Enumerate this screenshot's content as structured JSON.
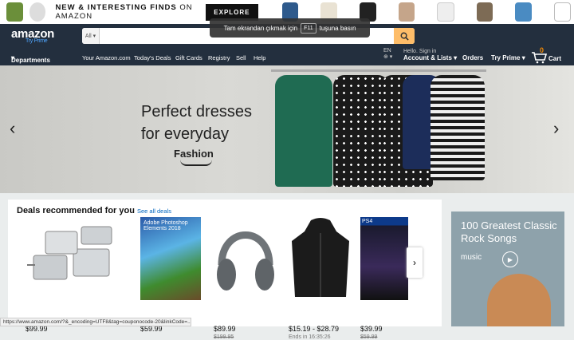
{
  "promo": {
    "title_bold": "NEW & INTERESTING FINDS",
    "title_rest": " ON AMAZON",
    "explore": "EXPLORE"
  },
  "nav": {
    "logo": "amazon",
    "logo_sub": "Try Prime",
    "search_category": "All",
    "search_placeholder": "",
    "departments": "Departments",
    "links": [
      "Your Amazon.com",
      "Today's Deals",
      "Gift Cards",
      "Registry",
      "Sell",
      "Help"
    ],
    "lang": "EN",
    "hello": "Hello. Sign in",
    "account": "Account & Lists",
    "orders": "Orders",
    "try_prime": "Try Prime",
    "cart": "Cart",
    "cart_count": "0"
  },
  "tooltip": {
    "prefix": "Tam ekrandan çıkmak için",
    "key": "F11",
    "suffix": "tuşuna basın"
  },
  "hero": {
    "line1": "Perfect dresses",
    "line2": "for everyday",
    "brand": "Fashion"
  },
  "deals": {
    "title": "Deals recommended for you",
    "see_all": "See all deals",
    "items": [
      {
        "price": "$99.99",
        "old": ""
      },
      {
        "price": "$59.99",
        "old": ""
      },
      {
        "price": "$89.99",
        "old": "$199.95"
      },
      {
        "price": "$15.19 - $28.79",
        "old": "",
        "ends": "Ends in 16:35:26"
      },
      {
        "price": "$39.99",
        "old": "$59.99"
      }
    ],
    "product_text": {
      "software": "Adobe Photoshop\nElements 2018",
      "game": "PS4"
    }
  },
  "side_ad": {
    "title": "100 Greatest Classic Rock Songs",
    "music": "music"
  },
  "status_url": "https://www.amazon.com/?&_encoding=UTF8&tag=couponocode-20&linkCode=..."
}
